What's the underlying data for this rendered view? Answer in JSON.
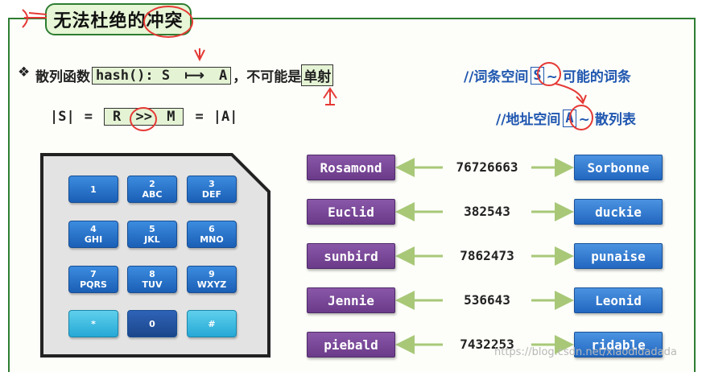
{
  "title": "无法杜绝的冲突",
  "hash_line": {
    "bullet": "❖",
    "prefix": "散列函数",
    "formula_left": "hash(): S",
    "maps_to": "⟼",
    "formula_target": "A",
    "middle": "，不可能是",
    "injective": "单射"
  },
  "size_line": {
    "s": "|S|",
    "eq1": "=",
    "r": "R",
    "gg": ">>",
    "m": "M",
    "eq2": "=",
    "a": "|A|"
  },
  "notes": {
    "vocab_prefix": "//词条空间",
    "vocab_symbol": "S",
    "vocab_suffix": "~ 可能的词条",
    "addr_prefix": "//地址空间",
    "addr_symbol": "A",
    "addr_suffix": "~ 散列表"
  },
  "keypad": [
    {
      "main": "1",
      "sub": ""
    },
    {
      "main": "2",
      "sub": "ABC"
    },
    {
      "main": "3",
      "sub": "DEF"
    },
    {
      "main": "4",
      "sub": "GHI"
    },
    {
      "main": "5",
      "sub": "JKL"
    },
    {
      "main": "6",
      "sub": "MNO"
    },
    {
      "main": "7",
      "sub": "PQRS"
    },
    {
      "main": "8",
      "sub": "TUV"
    },
    {
      "main": "9",
      "sub": "WXYZ"
    },
    {
      "main": "*",
      "sub": ""
    },
    {
      "main": "0",
      "sub": ""
    },
    {
      "main": "#",
      "sub": ""
    }
  ],
  "mappings": [
    {
      "left": "Rosamond",
      "number": "76726663",
      "right": "Sorbonne"
    },
    {
      "left": "Euclid",
      "number": "382543",
      "right": "duckie"
    },
    {
      "left": "sunbird",
      "number": "7862473",
      "right": "punaise"
    },
    {
      "left": "Jennie",
      "number": "536643",
      "right": "Leonid"
    },
    {
      "left": "piebald",
      "number": "7432253",
      "right": "ridable"
    }
  ],
  "watermark": "https://blog.csdn.net/xiaodidadada",
  "colors": {
    "frame": "#2e7d32",
    "title_bg": "#e6f6d6",
    "note_blue": "#1f56b0",
    "purple": "#6a3b8a",
    "blue": "#2267c0",
    "annotation_red": "#e53935",
    "arrow_green": "#a8c878"
  }
}
